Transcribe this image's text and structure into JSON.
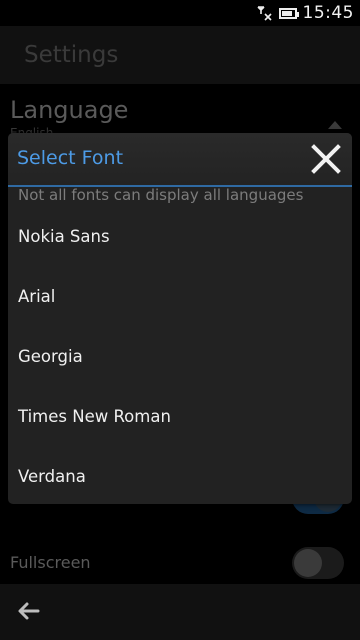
{
  "status_bar": {
    "time": "15:45",
    "signal_icon": "no-signal-icon",
    "battery_icon": "battery-icon"
  },
  "settings_page": {
    "title": "Settings",
    "language_label": "Language",
    "language_value": "English",
    "fullscreen_label": "Fullscreen"
  },
  "dialog": {
    "title": "Select Font",
    "note": "Not all fonts can display all languages",
    "fonts": [
      "Nokia Sans",
      "Arial",
      "Georgia",
      "Times New Roman",
      "Verdana"
    ],
    "close_icon": "close-icon"
  },
  "toolbar": {
    "back_icon": "back-arrow-icon"
  },
  "colors": {
    "accent": "#4d9be6",
    "dialog_bg": "#222222",
    "background": "#000000"
  }
}
